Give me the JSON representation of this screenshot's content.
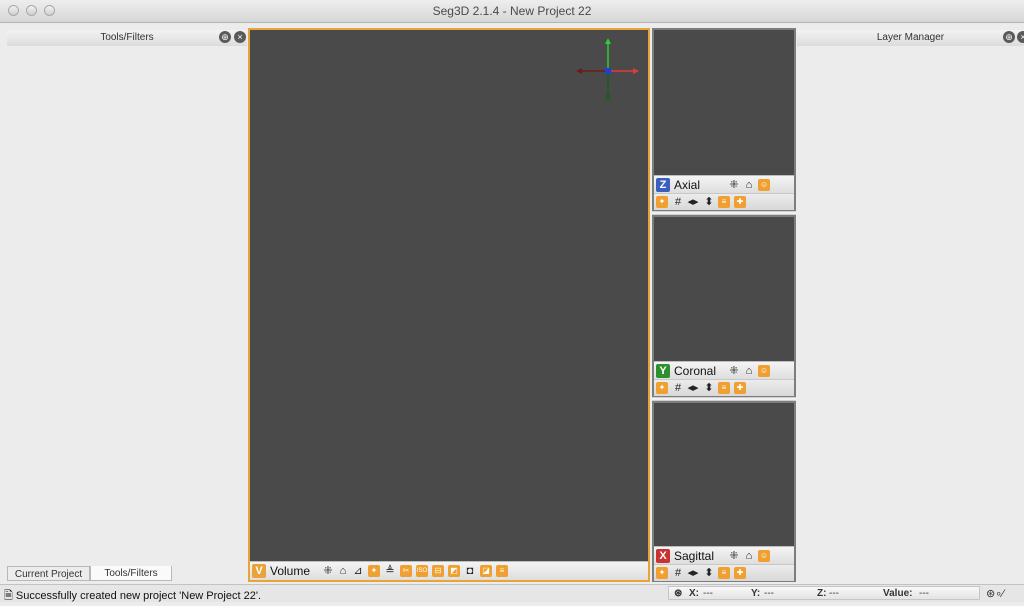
{
  "window": {
    "title": "Seg3D 2.1.4  - New Project 22"
  },
  "left_dock": {
    "title": "Tools/Filters",
    "tabs": [
      "Current Project",
      "Tools/Filters"
    ],
    "active_tab": "Tools/Filters"
  },
  "right_dock": {
    "title": "Layer Manager"
  },
  "main_viewer": {
    "letter": "V",
    "label": "Volume",
    "letter_color": "#e8a33a",
    "border_color": "#e8a33a"
  },
  "viewers": [
    {
      "letter": "Z",
      "label": "Axial",
      "letter_color": "#3a5fbf"
    },
    {
      "letter": "Y",
      "label": "Coronal",
      "letter_color": "#2e8f2e"
    },
    {
      "letter": "X",
      "label": "Sagittal",
      "letter_color": "#c83232"
    }
  ],
  "status": {
    "message": "Successfully created new project 'New Project 22'.",
    "x_label": "X:",
    "x_value": "---",
    "y_label": "Y:",
    "y_value": "---",
    "z_label": "Z:",
    "z_value": "---",
    "value_label": "Value:",
    "value_value": "---"
  },
  "icons": {
    "viewer_toolbar": [
      "collapse-icon",
      "lock-icon",
      "grid-icon",
      "picking-icon",
      "slices-icon",
      "clipping-icon",
      "iso-icon",
      "bbox-icon",
      "light-icon",
      "overlay-icon",
      "orientation-icon",
      "snap-icon"
    ],
    "slice_toolbar": [
      "collapse-icon",
      "lock-icon",
      "visibility-icon",
      "picking-icon",
      "grid-icon",
      "flip-horizontal-icon",
      "flip-vertical-icon",
      "overlay-icon",
      "snap-icon"
    ]
  }
}
